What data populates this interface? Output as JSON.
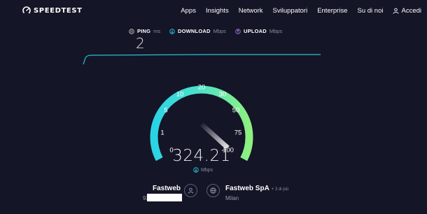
{
  "header": {
    "logo_text": "SPEEDTEST",
    "nav": [
      {
        "label": "Apps"
      },
      {
        "label": "Insights"
      },
      {
        "label": "Network"
      },
      {
        "label": "Sviluppatori"
      },
      {
        "label": "Enterprise"
      },
      {
        "label": "Su di noi"
      }
    ],
    "login_label": "Accedi"
  },
  "metrics": {
    "ping": {
      "label": "PING",
      "unit": "ms",
      "value": "2"
    },
    "download": {
      "label": "DOWNLOAD",
      "unit": "Mbps"
    },
    "upload": {
      "label": "UPLOAD",
      "unit": "Mbps"
    }
  },
  "gauge": {
    "ticks": [
      "0",
      "1",
      "5",
      "10",
      "20",
      "30",
      "50",
      "75",
      "100"
    ],
    "value": "324.21",
    "unit": "Mbps",
    "fill_fraction": 1.0
  },
  "connection": {
    "isp_name": "Fastweb",
    "ip_prefix": "93",
    "server_name": "Fastweb SpA",
    "server_more": "+ 3 di più",
    "server_city": "Milan"
  },
  "colors": {
    "background": "#141526",
    "gauge_cyan": "#2ad3e6",
    "gauge_green": "#8ef080",
    "download_accent": "#2ad3e6",
    "upload_accent": "#b07cf0",
    "ping_accent": "#e0d36a"
  }
}
